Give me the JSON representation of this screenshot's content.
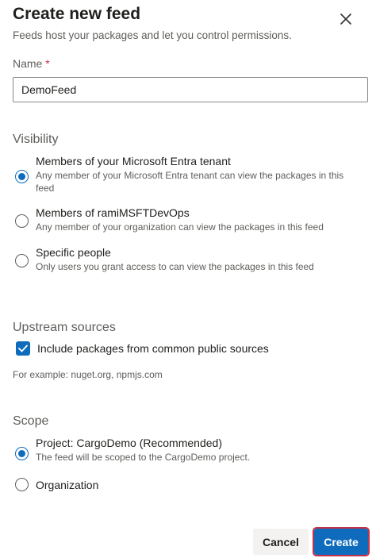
{
  "dialog": {
    "title": "Create new feed",
    "subtitle": "Feeds host your packages and let you control permissions."
  },
  "name": {
    "label": "Name",
    "required_mark": "*",
    "value": "DemoFeed"
  },
  "visibility": {
    "title": "Visibility",
    "options": [
      {
        "label": "Members of your Microsoft Entra tenant",
        "description": "Any member of your Microsoft Entra tenant can view the packages in this feed",
        "checked": true
      },
      {
        "label": "Members of ramiMSFTDevOps",
        "description": "Any member of your organization can view the packages in this feed",
        "checked": false
      },
      {
        "label": "Specific people",
        "description": "Only users you grant access to can view the packages in this feed",
        "checked": false
      }
    ]
  },
  "upstream": {
    "title": "Upstream sources",
    "checkbox_label": "Include packages from common public sources",
    "checked": true,
    "example": "For example: nuget.org, npmjs.com"
  },
  "scope": {
    "title": "Scope",
    "options": [
      {
        "label": "Project: CargoDemo (Recommended)",
        "description": "The feed will be scoped to the CargoDemo project.",
        "checked": true
      },
      {
        "label": "Organization",
        "checked": false
      }
    ]
  },
  "footer": {
    "cancel_label": "Cancel",
    "create_label": "Create"
  },
  "colors": {
    "accent": "#0f6cbd",
    "highlight": "#c4314b"
  },
  "icons": {
    "close": "close-icon",
    "check": "checkmark-icon"
  }
}
